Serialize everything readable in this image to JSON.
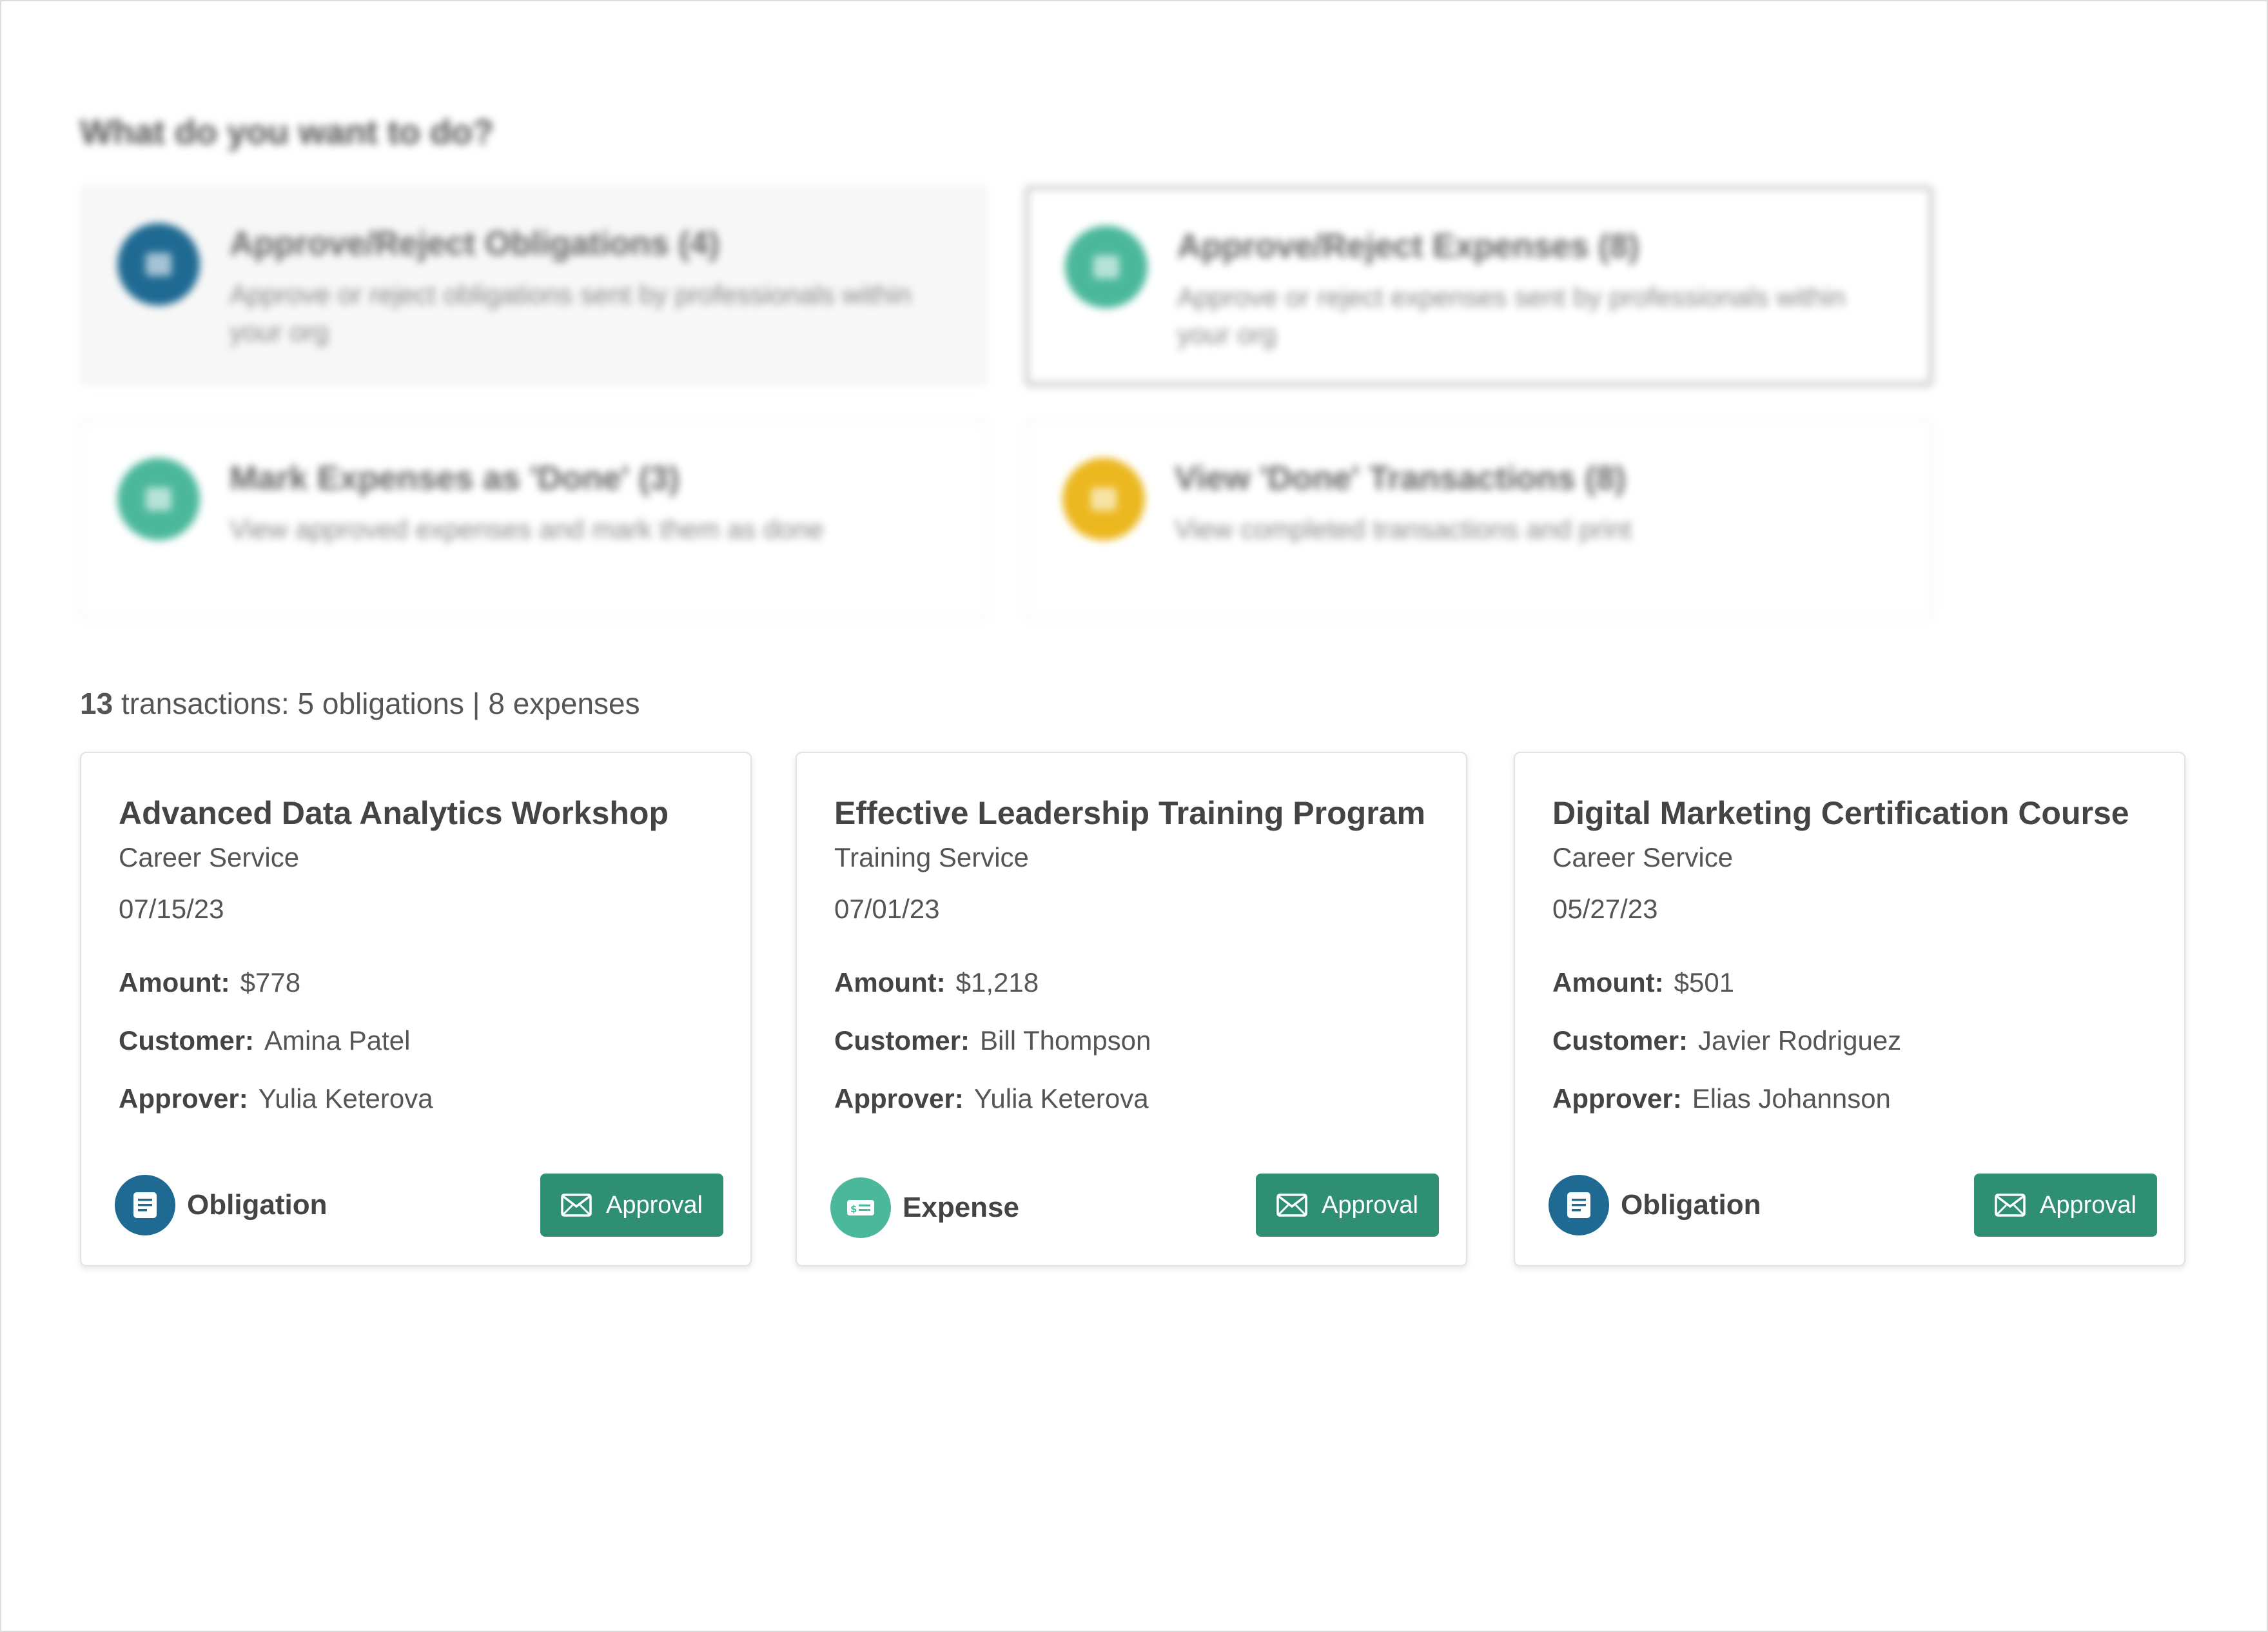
{
  "colors": {
    "obligation_blue": "#1f6a93",
    "expense_teal": "#4bb89b",
    "done_yellow": "#ecb820",
    "approval_green": "#2e8f72"
  },
  "prompt": {
    "title": "What do you want to do?",
    "actions": [
      {
        "title": "Approve/Reject Obligations (4)",
        "description": "Approve or reject obligations sent by professionals within your org",
        "icon": "document-icon"
      },
      {
        "title": "Approve/Reject Expenses (8)",
        "description": "Approve or reject expenses sent by professionals within your org",
        "icon": "money-icon"
      },
      {
        "title": "Mark Expenses as 'Done' (3)",
        "description": "View approved expenses and mark them as done",
        "icon": "money-icon"
      },
      {
        "title": "View 'Done' Transactions (8)",
        "description": "View completed transactions and print",
        "icon": "check-icon"
      }
    ]
  },
  "summary": {
    "count": "13",
    "rest": " transactions: 5 obligations | 8 expenses"
  },
  "labels": {
    "amount": "Amount:",
    "customer": "Customer:",
    "approver": "Approver:"
  },
  "transactions": [
    {
      "title": "Advanced Data Analytics Workshop",
      "service": "Career Service",
      "date": "07/15/23",
      "amount": "$778",
      "customer": "Amina Patel",
      "approver": "Yulia Keterova",
      "type": "Obligation",
      "button": "Approval"
    },
    {
      "title": "Effective Leadership Training Program",
      "service": "Training Service",
      "date": "07/01/23",
      "amount": "$1,218",
      "customer": "Bill Thompson",
      "approver": "Yulia Keterova",
      "type": "Expense",
      "button": "Approval"
    },
    {
      "title": "Digital Marketing Certification Course",
      "service": "Career Service",
      "date": "05/27/23",
      "amount": "$501",
      "customer": "Javier Rodriguez",
      "approver": "Elias Johannson",
      "type": "Obligation",
      "button": "Approval"
    }
  ]
}
